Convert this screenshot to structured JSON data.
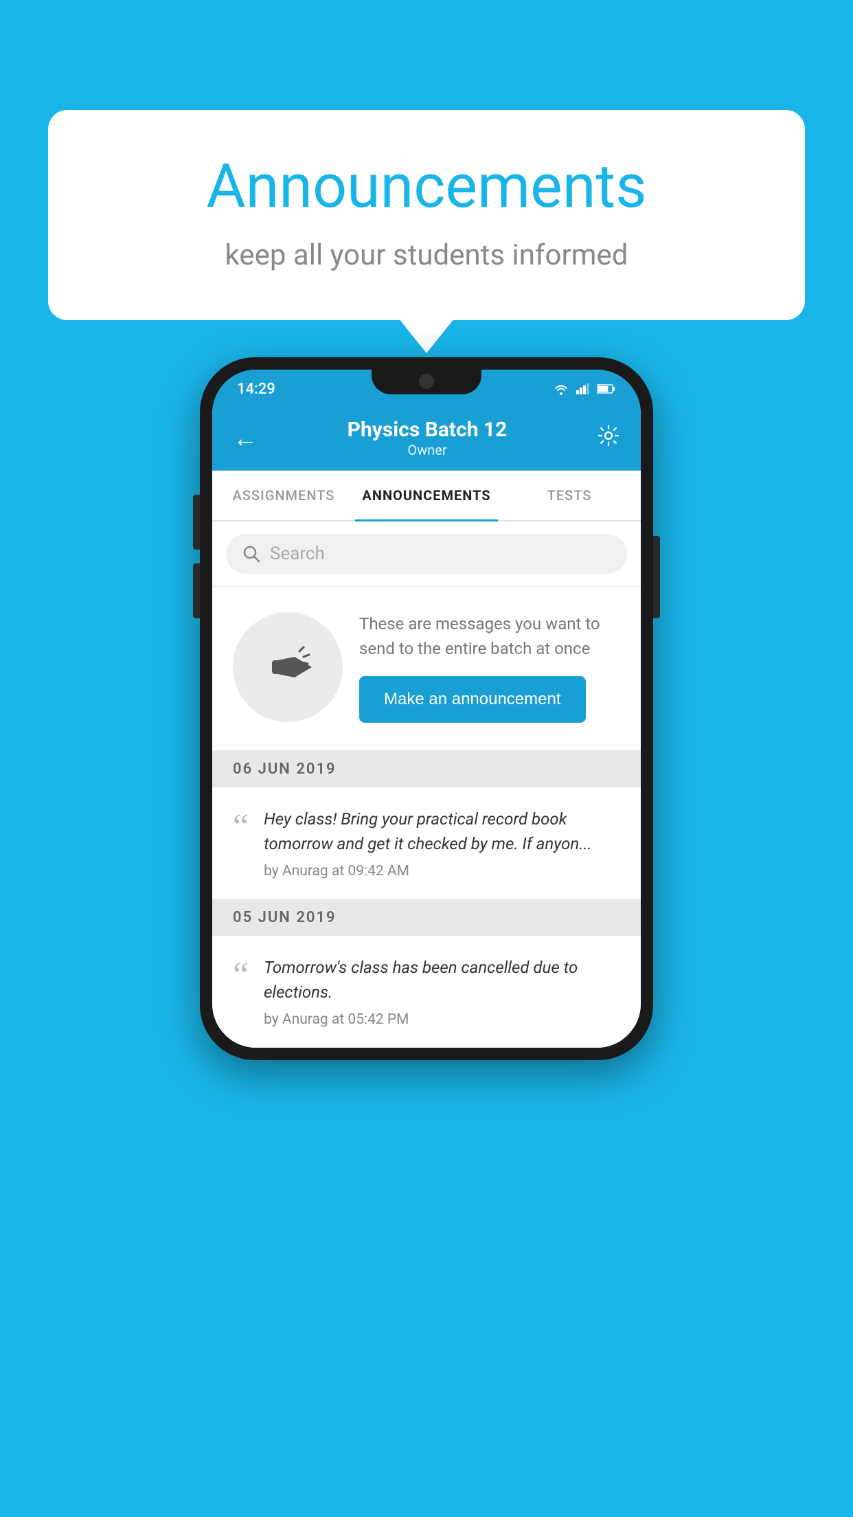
{
  "speech_bubble": {
    "title": "Announcements",
    "subtitle": "keep all your students informed"
  },
  "status_bar": {
    "time": "14:29"
  },
  "app_header": {
    "title": "Physics Batch 12",
    "subtitle": "Owner",
    "back_label": "←",
    "settings_label": "⚙"
  },
  "tabs": [
    {
      "label": "ASSIGNMENTS",
      "active": false
    },
    {
      "label": "ANNOUNCEMENTS",
      "active": true
    },
    {
      "label": "TESTS",
      "active": false
    }
  ],
  "search": {
    "placeholder": "Search"
  },
  "promo": {
    "description": "These are messages you want to send to the entire batch at once",
    "button_label": "Make an announcement"
  },
  "date_groups": [
    {
      "date": "06  JUN  2019",
      "announcements": [
        {
          "text": "Hey class! Bring your practical record book tomorrow and get it checked by me. If anyon...",
          "meta": "by Anurag at 09:42 AM"
        }
      ]
    },
    {
      "date": "05  JUN  2019",
      "announcements": [
        {
          "text": "Tomorrow's class has been cancelled due to elections.",
          "meta": "by Anurag at 05:42 PM"
        }
      ]
    }
  ]
}
